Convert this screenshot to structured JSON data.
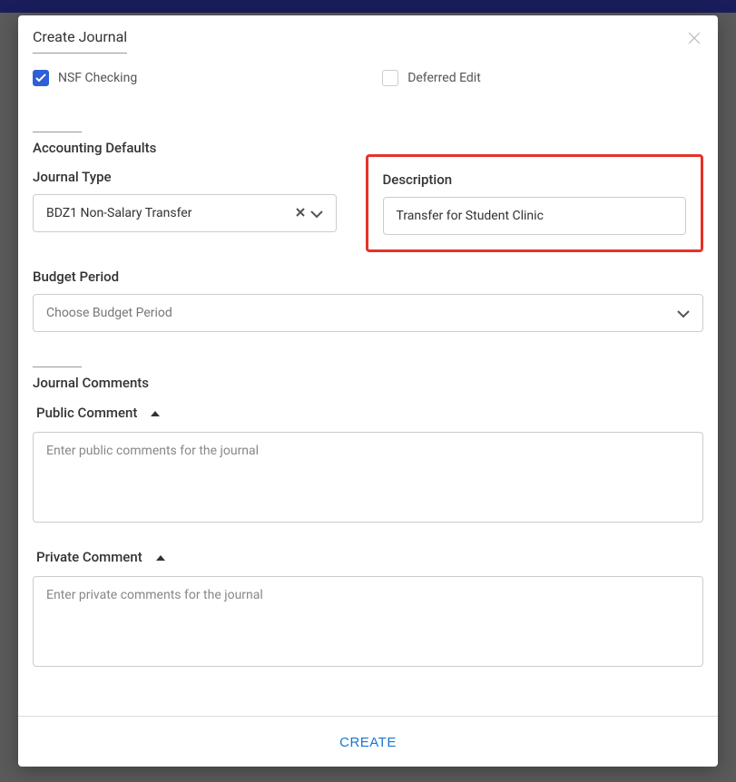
{
  "modal": {
    "title": "Create Journal"
  },
  "checkboxes": {
    "nsf": {
      "label": "NSF Checking",
      "checked": true
    },
    "deferred": {
      "label": "Deferred Edit",
      "checked": false
    }
  },
  "accounting_defaults": {
    "title": "Accounting Defaults",
    "journal_type": {
      "label": "Journal Type",
      "value": "BDZ1 Non-Salary Transfer"
    },
    "description": {
      "label": "Description",
      "value": "Transfer for Student Clinic"
    },
    "budget_period": {
      "label": "Budget Period",
      "placeholder": "Choose Budget Period"
    }
  },
  "journal_comments": {
    "title": "Journal Comments",
    "public": {
      "label": "Public Comment",
      "placeholder": "Enter public comments for the journal"
    },
    "private": {
      "label": "Private Comment",
      "placeholder": "Enter private comments for the journal"
    }
  },
  "footer": {
    "create_label": "CREATE"
  }
}
